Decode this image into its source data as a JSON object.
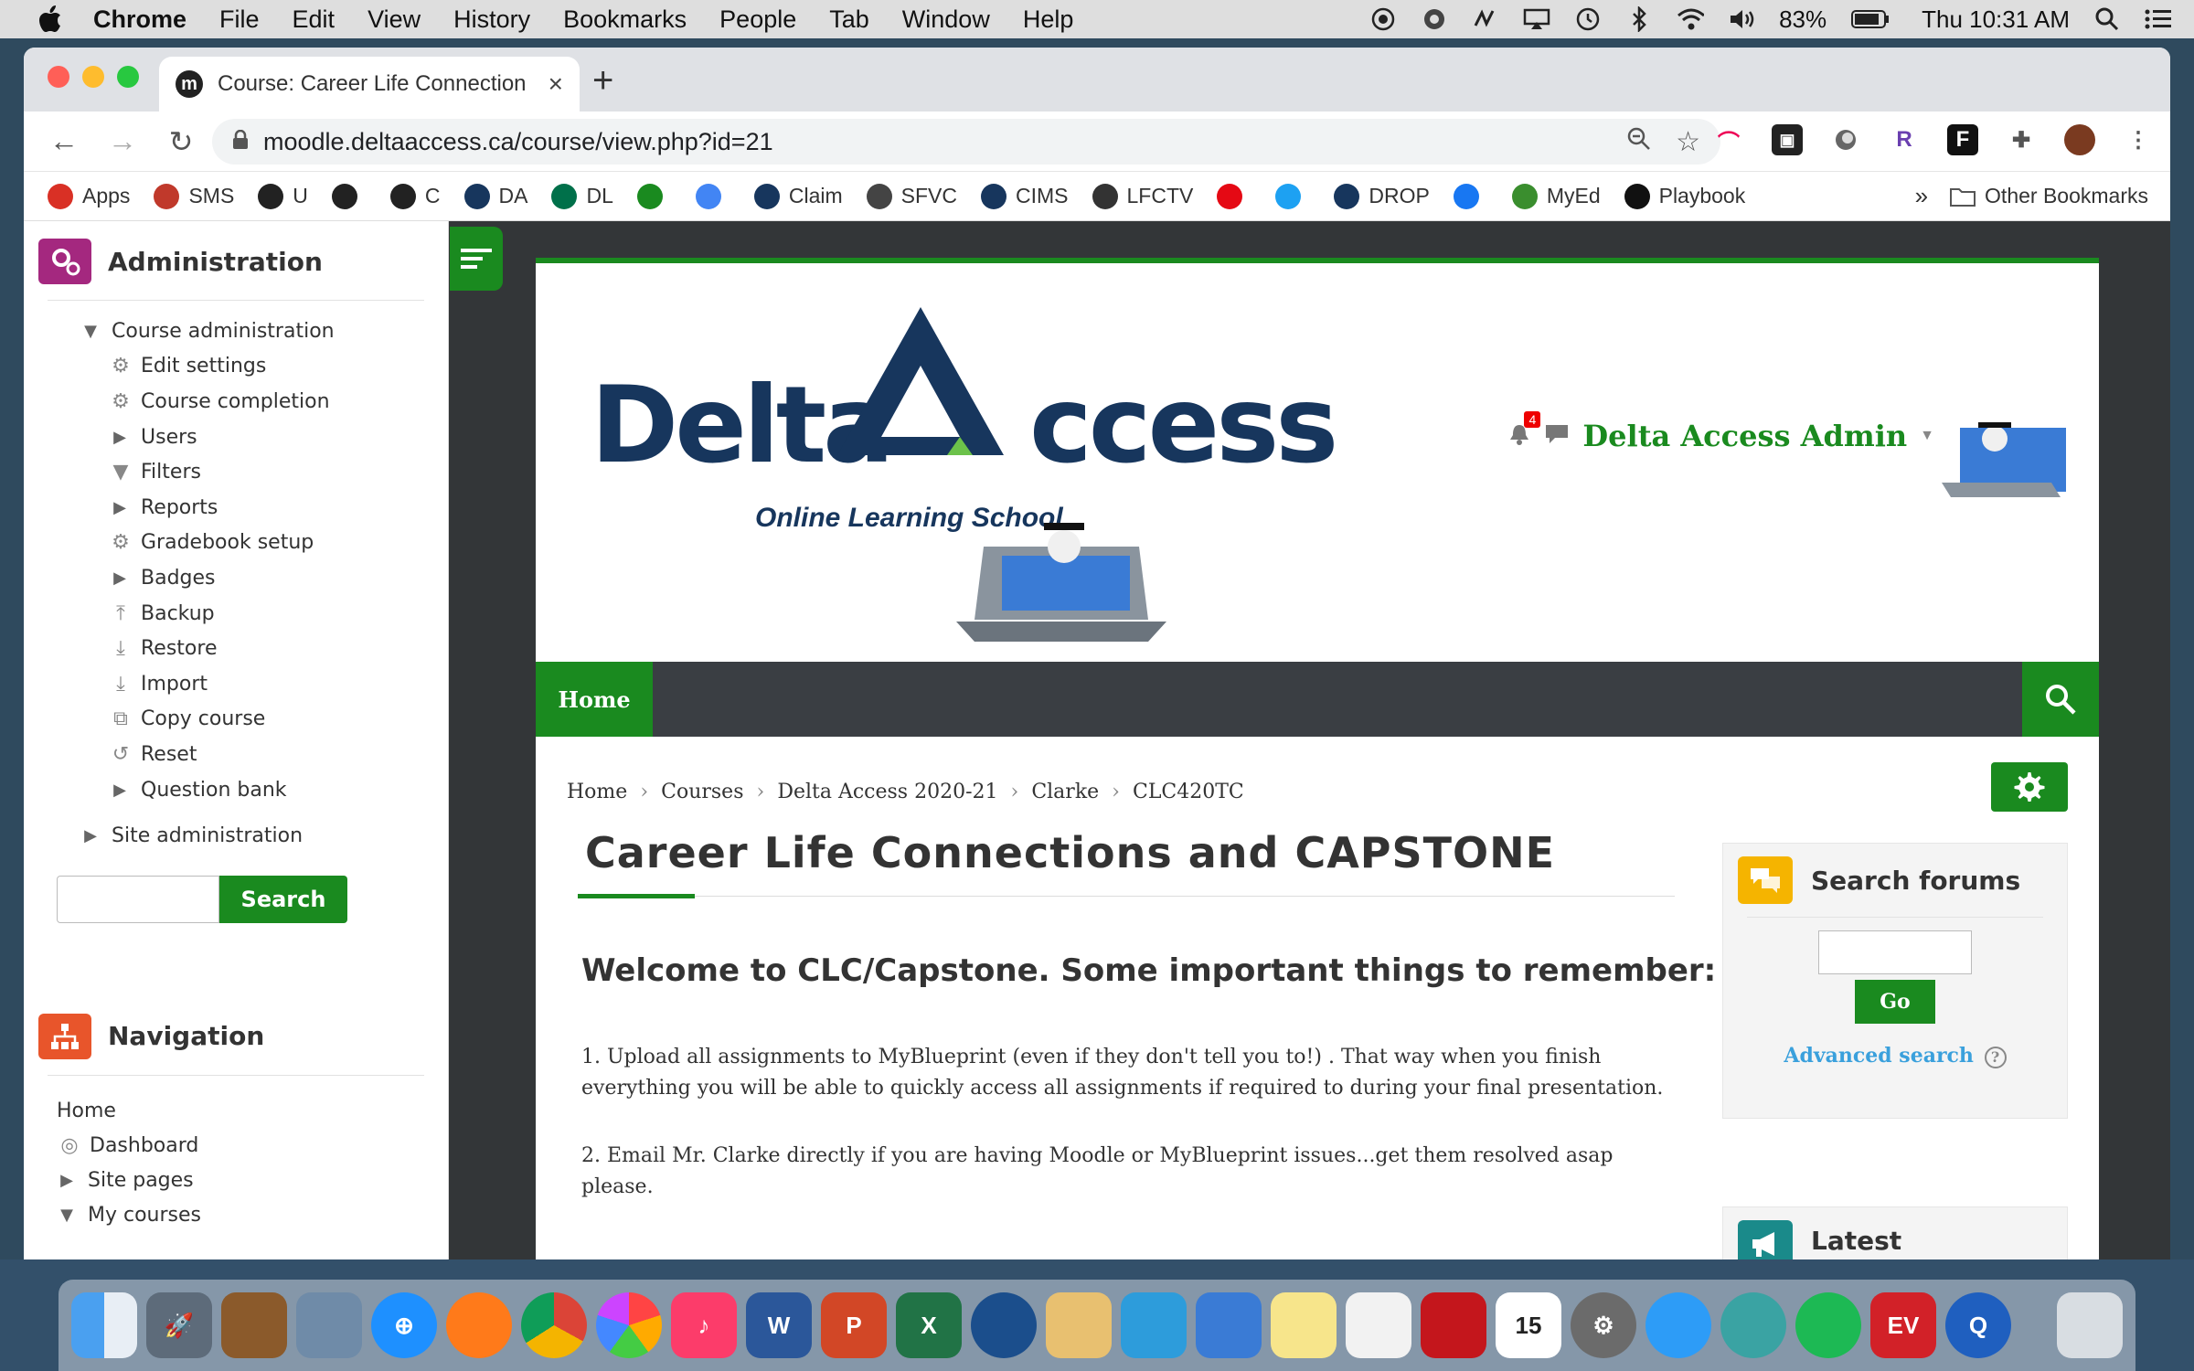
{
  "menubar": {
    "app": "Chrome",
    "items": [
      "File",
      "Edit",
      "View",
      "History",
      "Bookmarks",
      "People",
      "Tab",
      "Window",
      "Help"
    ],
    "battery": "83%",
    "clock": "Thu 10:31 AM"
  },
  "browser": {
    "tab_title": "Course: Career Life Connection",
    "url": "moodle.deltaaccess.ca/course/view.php?id=21",
    "bookmarks": [
      {
        "label": "Apps",
        "icon": "apps-grid-icon",
        "color": "#d93025"
      },
      {
        "label": "SMS",
        "icon": "sms-icon",
        "color": "#c0392b"
      },
      {
        "label": "U",
        "icon": "moodle-icon",
        "color": "#222222"
      },
      {
        "label": "",
        "icon": "moodle-icon",
        "color": "#222222"
      },
      {
        "label": "C",
        "icon": "moodle-icon",
        "color": "#222222"
      },
      {
        "label": "DA",
        "icon": "delta-icon",
        "color": "#17365d"
      },
      {
        "label": "DL",
        "icon": "starbucks-icon",
        "color": "#00704a"
      },
      {
        "label": "",
        "icon": "id-icon",
        "color": "#1a8a1f"
      },
      {
        "label": "",
        "icon": "google-icon",
        "color": "#4285f4"
      },
      {
        "label": "Claim",
        "icon": "delta-icon",
        "color": "#17365d"
      },
      {
        "label": "SFVC",
        "icon": "sfvc-icon",
        "color": "#444444"
      },
      {
        "label": "CIMS",
        "icon": "delta-icon",
        "color": "#17365d"
      },
      {
        "label": "LFCTV",
        "icon": "lfctv-icon",
        "color": "#333333"
      },
      {
        "label": "",
        "icon": "netflix-icon",
        "color": "#e50914"
      },
      {
        "label": "",
        "icon": "twitter-icon",
        "color": "#1da1f2"
      },
      {
        "label": "DROP",
        "icon": "delta-icon",
        "color": "#17365d"
      },
      {
        "label": "",
        "icon": "facebook-icon",
        "color": "#1877f2"
      },
      {
        "label": "MyEd",
        "icon": "myed-icon",
        "color": "#3a8e2e"
      },
      {
        "label": "Playbook",
        "icon": "playbook-icon",
        "color": "#111111"
      }
    ],
    "other_bookmarks": "Other Bookmarks",
    "overflow": "»"
  },
  "sidebar": {
    "admin_title": "Administration",
    "course_admin": "Course administration",
    "admin_items": [
      {
        "label": "Edit settings",
        "icon": "gear-icon",
        "expandable": false
      },
      {
        "label": "Course completion",
        "icon": "gear-icon",
        "expandable": false
      },
      {
        "label": "Users",
        "icon": "",
        "expandable": true
      },
      {
        "label": "Filters",
        "icon": "filter-icon",
        "expandable": false
      },
      {
        "label": "Reports",
        "icon": "",
        "expandable": true
      },
      {
        "label": "Gradebook setup",
        "icon": "gear-icon",
        "expandable": false
      },
      {
        "label": "Badges",
        "icon": "",
        "expandable": true
      },
      {
        "label": "Backup",
        "icon": "upload-icon",
        "expandable": false
      },
      {
        "label": "Restore",
        "icon": "download-icon",
        "expandable": false
      },
      {
        "label": "Import",
        "icon": "download-icon",
        "expandable": false
      },
      {
        "label": "Copy course",
        "icon": "copy-icon",
        "expandable": false
      },
      {
        "label": "Reset",
        "icon": "reset-icon",
        "expandable": false
      },
      {
        "label": "Question bank",
        "icon": "",
        "expandable": true
      }
    ],
    "site_admin": "Site administration",
    "search_button": "Search",
    "nav_title": "Navigation",
    "nav_items": [
      "Home",
      "Dashboard",
      "Site pages",
      "My courses"
    ]
  },
  "header": {
    "logo_left": "Delta",
    "logo_right": "ccess",
    "logo_tagline": "Online Learning School",
    "notifications_count": "4",
    "user_name": "Delta Access Admin"
  },
  "navbar": {
    "home": "Home"
  },
  "breadcrumb": [
    "Home",
    "Courses",
    "Delta Access 2020-21",
    "Clarke",
    "CLC420TC"
  ],
  "course": {
    "title": "Career Life Connections and CAPSTONE",
    "welcome": "Welcome to CLC/Capstone.  Some important things to remember:",
    "para1": "1.  Upload all assignments to MyBlueprint (even if they don't tell you to!) . That way when you finish everything you will be able to quickly access all assignments if required to during your final presentation.",
    "para2": "2.  Email Mr. Clarke directly if you are having Moodle or MyBlueprint issues...get them resolved asap please."
  },
  "search_forums": {
    "title": "Search forums",
    "go": "Go",
    "advanced": "Advanced search"
  },
  "latest": {
    "title": "Latest announcements"
  },
  "colors": {
    "brand_green": "#1a8a1f",
    "navy": "#17365d",
    "navbar": "#3a3e43"
  }
}
